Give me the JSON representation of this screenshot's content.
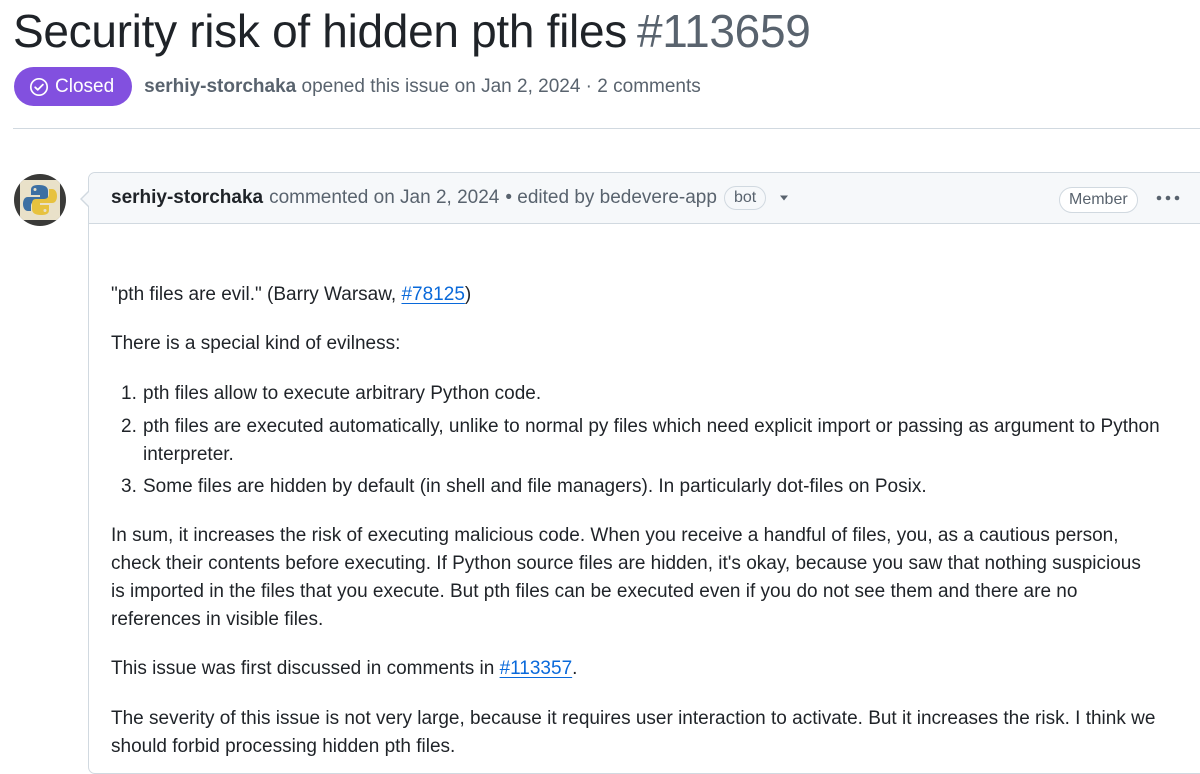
{
  "issue": {
    "title": "Security risk of hidden pth files",
    "number": "#113659",
    "state": "Closed",
    "author": "serhiy-storchaka",
    "opened_text": "opened this issue on Jan 2, 2024 · 2 comments"
  },
  "comment": {
    "author": "serhiy-storchaka",
    "commented_text": "commented on Jan 2, 2024",
    "edited_text": "• edited by bedevere-app",
    "bot_label": "bot",
    "role_badge": "Member",
    "more_label": "•••",
    "body": {
      "p1_prefix": "\"pth files are evil.\" (Barry Warsaw, ",
      "p1_link": "#78125",
      "p1_suffix": ")",
      "p2": "There is a special kind of evilness:",
      "list": [
        {
          "num": "1.",
          "line1": "pth files allow to execute arbitrary Python code."
        },
        {
          "num": "2.",
          "line1": "pth files are executed automatically, unlike to normal py files which need explicit import or passing as argument to Python",
          "line2": "interpreter."
        },
        {
          "num": "3.",
          "line1": "Some files are hidden by default (in shell and file managers). In particularly dot-files on Posix."
        }
      ],
      "p3_lines": [
        "In sum, it increases the risk of executing malicious code. When you receive a handful of files, you, as a cautious person,",
        "check their contents before executing. If Python source files are hidden, it's okay, because you saw that nothing suspicious",
        "is imported in the files that you execute. But pth files can be executed even if you do not see them and there are no",
        "references in visible files."
      ],
      "p4_prefix": "This issue was first discussed in comments in ",
      "p4_link": "#113357",
      "p4_suffix": ".",
      "p5_lines": [
        "The severity of this issue is not very large, because it requires user interaction to activate. But it increases the risk. I think we",
        "should forbid processing hidden pth files."
      ]
    }
  },
  "colors": {
    "closed_badge": "#8250df",
    "link": "#0969da",
    "muted_text": "#59636e",
    "border": "#d1d9e0",
    "header_bg": "#f6f8fa"
  },
  "icons": {
    "state": "check-circle-icon",
    "dropdown": "triangle-down-icon",
    "more": "kebab-horizontal-icon",
    "avatar": "python-logo-avatar"
  }
}
